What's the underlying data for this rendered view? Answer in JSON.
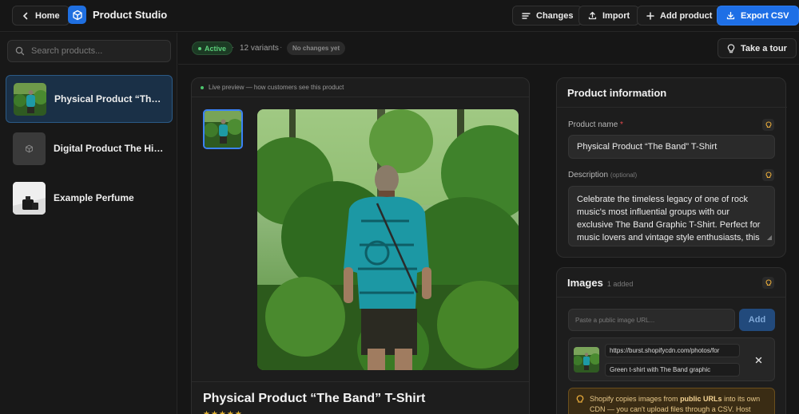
{
  "header": {
    "home_label": "Home",
    "app_title": "Product Studio",
    "changes_label": "Changes",
    "import_label": "Import",
    "add_product_label": "Add product",
    "export_label": "Export CSV"
  },
  "sidebar": {
    "search_placeholder": "Search products...",
    "products": [
      {
        "name": "Physical Product “The B…",
        "active": true
      },
      {
        "name": "Digital Product The Hist…",
        "active": false
      },
      {
        "name": "Example Perfume",
        "active": false
      }
    ]
  },
  "subbar": {
    "status": "Active",
    "variants": "12 variants",
    "change_state": "No changes yet",
    "tour_label": "Take a tour"
  },
  "preview": {
    "header_text": "Live preview — how customers see this product",
    "title": "Physical Product “The Band” T-Shirt",
    "stars": "★★★★★"
  },
  "product_info": {
    "card_title": "Product information",
    "name_label": "Product name",
    "name_required_mark": "*",
    "name_value": "Physical Product “The Band” T-Shirt",
    "description_label": "Description",
    "description_optional": "(optional)",
    "description_value": "Celebrate the timeless legacy of one of rock music's most influential groups with our exclusive The Band Graphic T-Shirt. Perfect for music lovers and vintage style enthusiasts, this"
  },
  "images": {
    "card_title": "Images",
    "count_label": "1 added",
    "url_placeholder": "Paste a public image URL...",
    "add_label": "Add",
    "items": [
      {
        "url": "https://burst.shopifycdn.com/photos/for",
        "alt": "Green t-shirt with The Band graphic"
      }
    ],
    "notice_prefix": "Shopify copies images from ",
    "notice_bold": "public URLs",
    "notice_suffix": " into its own CDN — you can't upload files through a CSV. Host"
  },
  "colors": {
    "accent": "#1e6fe6",
    "active_green": "#5bd07a",
    "warning": "#e8c98a"
  }
}
